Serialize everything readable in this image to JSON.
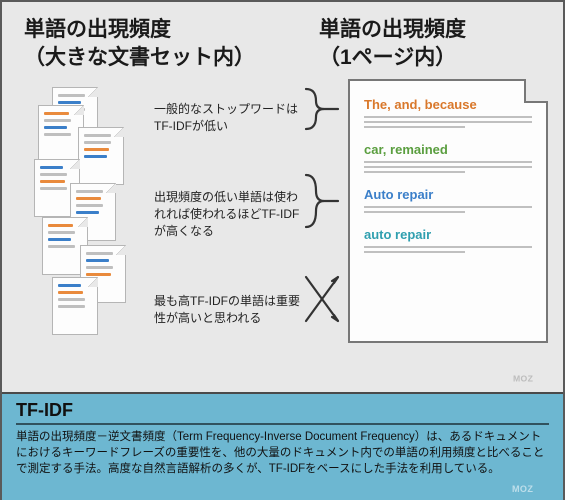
{
  "headings": {
    "left_l1": "単語の出現頻度",
    "left_l2": "（大きな文書セット内）",
    "right_l1": "単語の出現頻度",
    "right_l2": "（1ページ内）"
  },
  "notes": {
    "n1": "一般的なストップワードはTF-IDFが低い",
    "n2": "出現頻度の低い単語は使われれば使われるほどTF-IDFが高くなる",
    "n3": "最も高TF-IDFの単語は重要性が高いと思われる"
  },
  "phrases": {
    "p1": "The, and, because",
    "p2": "car, remained",
    "p3": "Auto repair",
    "p4": "auto repair"
  },
  "bottom": {
    "title": "TF-IDF",
    "body": "単語の出現頻度－逆文書頻度（Term Frequency-Inverse Document Frequency）は、あるドキュメントにおけるキーワードフレーズの重要性を、他の大量のドキュメント内での単語の利用頻度と比べることで測定する手法。高度な自然言語解析の多くが、TF-IDFをベースにした手法を利用している。"
  },
  "brand": "MOZ"
}
